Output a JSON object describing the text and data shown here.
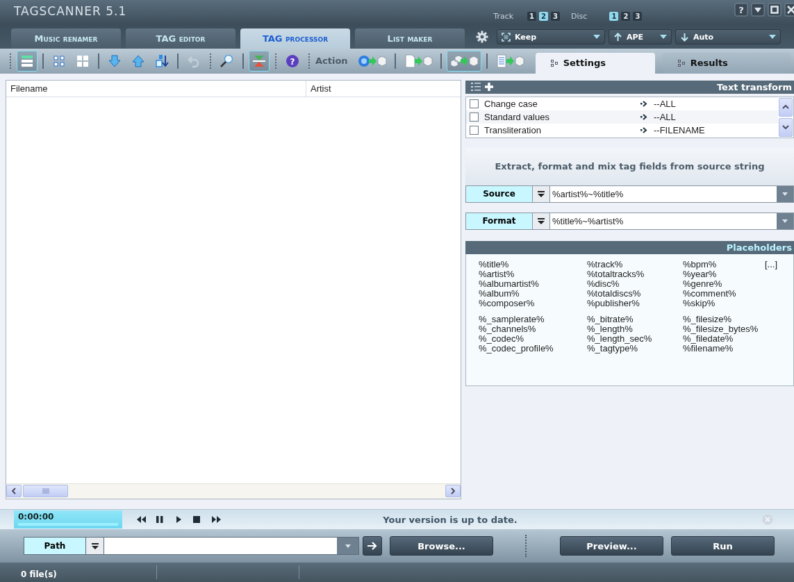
{
  "window": {
    "title": "TAGSCANNER 5.1",
    "buttons": [
      {
        "kind": "help",
        "text": "?"
      },
      {
        "kind": "minimize"
      },
      {
        "kind": "maximize"
      },
      {
        "kind": "close"
      }
    ]
  },
  "mode_tabs": [
    {
      "label": "Music renamer",
      "selected": false
    },
    {
      "label": "TAG editor",
      "selected": false
    },
    {
      "label": "TAG processor",
      "selected": true
    },
    {
      "label": "List maker",
      "selected": false
    }
  ],
  "track_selector": {
    "label": "Track",
    "options": [
      {
        "label": "1",
        "selected": false
      },
      {
        "label": "2",
        "selected": true
      },
      {
        "label": "3",
        "selected": false
      }
    ]
  },
  "disc_selector": {
    "label": "Disc",
    "options": [
      {
        "label": "1",
        "selected": true
      },
      {
        "label": "2",
        "selected": false
      },
      {
        "label": "3",
        "selected": false
      }
    ]
  },
  "dropdowns": [
    {
      "kind": "case",
      "value": "Keep"
    },
    {
      "kind": "write",
      "value": "APE"
    },
    {
      "kind": "read",
      "value": "Auto"
    }
  ],
  "toolbar": [
    {
      "kind": "dots"
    },
    {
      "kind": "list-view",
      "on": true
    },
    {
      "kind": "sep"
    },
    {
      "kind": "grid-small",
      "on": false
    },
    {
      "kind": "grid",
      "on": false
    },
    {
      "kind": "sep"
    },
    {
      "kind": "arrow-down",
      "on": false
    },
    {
      "kind": "arrow-up",
      "on": false
    },
    {
      "kind": "sort",
      "on": false
    },
    {
      "kind": "sep"
    },
    {
      "kind": "undo",
      "on": false
    },
    {
      "kind": "dots"
    },
    {
      "kind": "search",
      "on": false
    },
    {
      "kind": "sep"
    },
    {
      "kind": "split",
      "on": true
    },
    {
      "kind": "dots"
    },
    {
      "kind": "help",
      "on": false,
      "text": "?"
    },
    {
      "kind": "dots"
    },
    {
      "kind": "label",
      "text": "Action"
    },
    {
      "kind": "web-to-tag",
      "on": false
    },
    {
      "kind": "sep"
    },
    {
      "kind": "file-to-tag",
      "on": false
    },
    {
      "kind": "sep"
    },
    {
      "kind": "files-to-tag",
      "on": true
    },
    {
      "kind": "sep"
    },
    {
      "kind": "text-to-tag",
      "on": false
    }
  ],
  "panel_tabs": [
    {
      "label": "Settings",
      "selected": true
    },
    {
      "label": "Results",
      "selected": false
    }
  ],
  "file_list": {
    "columns": [
      "Filename",
      "Artist"
    ]
  },
  "text_transform": {
    "title": "Text transform",
    "rows": [
      {
        "label": "Change case",
        "checked": false,
        "target": "--ALL"
      },
      {
        "label": "Standard values",
        "checked": false,
        "target": "--ALL"
      },
      {
        "label": "Transliteration",
        "checked": false,
        "target": "--FILENAME"
      }
    ]
  },
  "extract": {
    "heading": "Extract, format and mix tag fields from source string",
    "fields": [
      {
        "label": "Source",
        "value": "%artist%~%title%"
      },
      {
        "label": "Format",
        "value": "%title%~%artist%"
      }
    ]
  },
  "placeholders": {
    "title": "Placeholders",
    "more": "[...]",
    "groups": [
      [
        [
          "%title%",
          "%artist%",
          "%albumartist%",
          "%album%",
          "%composer%"
        ],
        [
          "%track%",
          "%totaltracks%",
          "%disc%",
          "%totaldiscs%",
          "%publisher%"
        ],
        [
          "%bpm%",
          "%year%",
          "%genre%",
          "%comment%",
          "%skip%"
        ]
      ],
      [
        [
          "%_samplerate%",
          "%_channels%",
          "%_codec%",
          "%_codec_profile%"
        ],
        [
          "%_bitrate%",
          "%_length%",
          "%_length_sec%",
          "%_tagtype%"
        ],
        [
          "%_filesize%",
          "%_filesize_bytes%",
          "%_filedate%",
          "%filename%"
        ]
      ]
    ]
  },
  "player": {
    "time": "0:00:00",
    "message": "Your version is up to date."
  },
  "path": {
    "label": "Path"
  },
  "buttons": [
    "Browse...",
    "Preview...",
    "Run"
  ],
  "status_bar": [
    "0 file(s)"
  ]
}
